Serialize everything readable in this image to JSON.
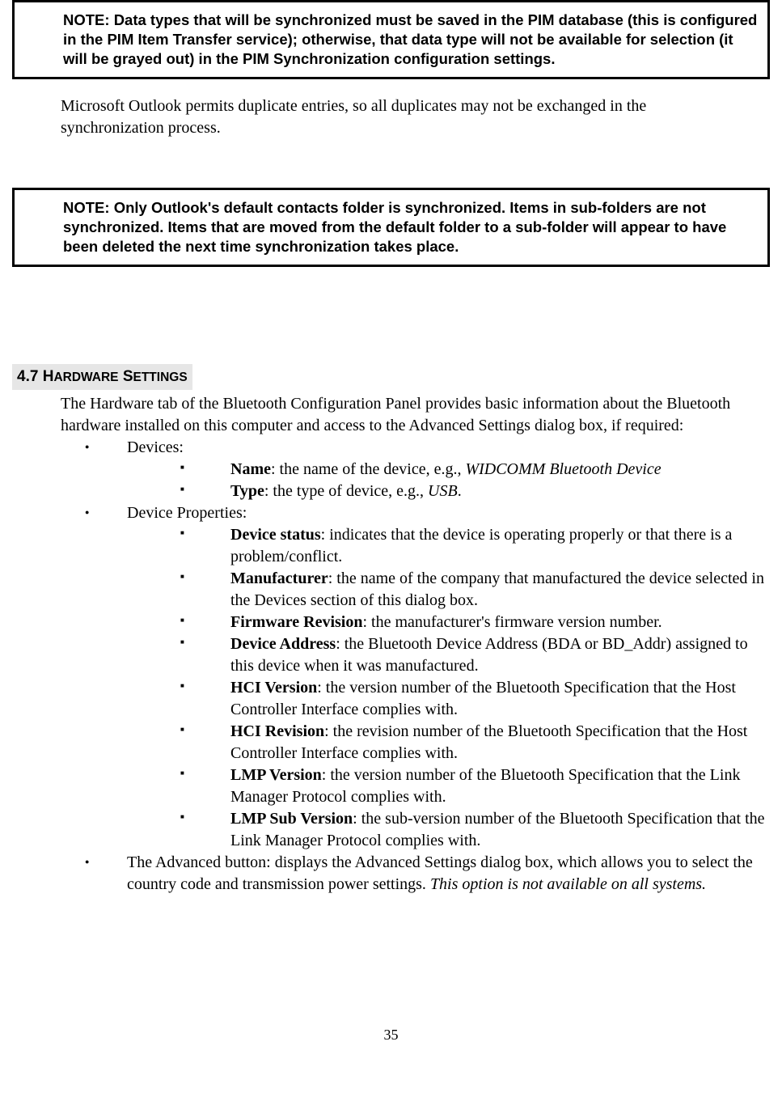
{
  "notes": {
    "note1": "NOTE: Data types that will be synchronized must be saved in the PIM database (this is configured in the PIM Item Transfer service); otherwise, that data type will not be available for selection (it will be grayed out) in the PIM Synchronization configuration settings.",
    "note2": "NOTE: Only Outlook's default contacts folder is synchronized. Items in sub-folders are not synchronized. Items that are moved from the default folder to a sub-folder will appear to have been deleted the next time synchronization takes place."
  },
  "paragraphs": {
    "outlook_dup": "Microsoft Outlook permits duplicate entries, so all duplicates may not be exchanged in the synchronization process."
  },
  "section": {
    "num": "4.7 ",
    "h_start": "H",
    "h_rest": "ARDWARE",
    "s_start": "S",
    "s_rest": "ETTINGS",
    "intro": "The Hardware tab of the Bluetooth Configuration Panel provides basic information about the Bluetooth hardware installed on this computer and access to the Advanced Settings dialog box, if required:"
  },
  "list": {
    "devices_label": "Devices:",
    "devices": {
      "name_label": "Name",
      "name_text": ": the name of the device, e.g., ",
      "name_example": "WIDCOMM Bluetooth Device",
      "type_label": "Type",
      "type_text": ": the type of device, e.g., ",
      "type_example": "USB",
      "type_period": "."
    },
    "props_label": "Device Properties:",
    "props": {
      "status_label": "Device status",
      "status_text": ": indicates that the device is operating properly or that there is a",
      "status_text2": "problem/conflict.",
      "mfr_label": "Manufacturer",
      "mfr_text": ": the name of the company that manufactured the device selected in the Devices section of this dialog box.",
      "fw_label": "Firmware Revision",
      "fw_text": ": the manufacturer's firmware version number.",
      "addr_label": "Device Address",
      "addr_text": ": the Bluetooth Device Address (BDA or BD_Addr) assigned to this device when it was manufactured.",
      "hciv_label": "HCI Version",
      "hciv_text": ": the version number of the Bluetooth Specification that the Host Controller Interface complies with.",
      "hcir_label": "HCI Revision",
      "hcir_text": ": the revision number of the Bluetooth Specification that the Host Controller Interface complies with.",
      "lmpv_label": "LMP Version",
      "lmpv_text": ": the version number of the Bluetooth Specification that the Link Manager Protocol complies with.",
      "lmps_label": "LMP Sub Version",
      "lmps_text": ": the sub-version number of the Bluetooth Specification that the Link Manager Protocol complies with."
    },
    "advanced_text1": "The Advanced button: displays the Advanced Settings dialog box, which allows you to select the country code and transmission power settings. ",
    "advanced_italic": "This option is not available on all systems."
  },
  "page_number": "35"
}
